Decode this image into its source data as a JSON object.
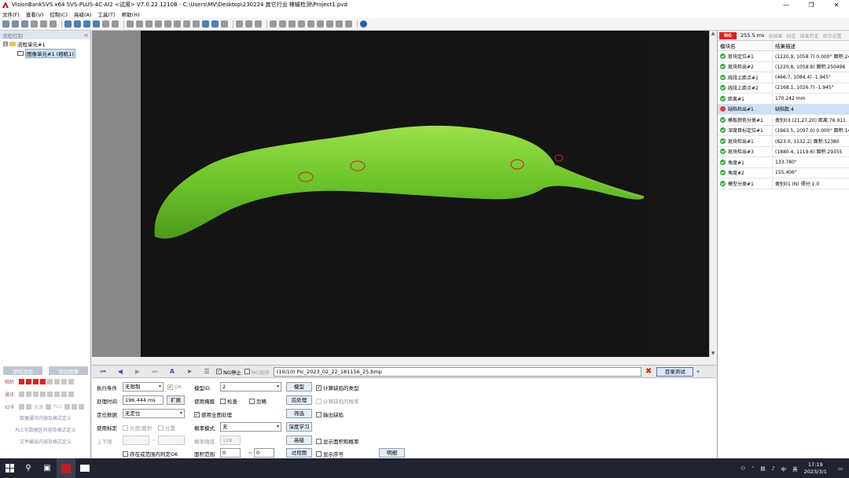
{
  "titlebar": {
    "title": "VisionBankSVS x64 SVS-PLUS-4C-AI2 <试用> V7.0.22.1210B - C:\\Users\\MV\\Desktop\\230224 其它行业 辣椒检测\\Project1.pvd"
  },
  "window_controls": {
    "minimize": "—",
    "restore": "❐",
    "close": "✕"
  },
  "menu": [
    "文件(F)",
    "查看(V)",
    "控制(C)",
    "高级(A)",
    "工具(T)",
    "帮助(H)"
  ],
  "left_panel": {
    "header": "流程控制",
    "pin": "⊲",
    "tree": [
      {
        "expander": "⊟",
        "label": "流程单元#1"
      },
      {
        "label": "图像单元#1 (相机1)"
      }
    ],
    "add_flow": "添加流程",
    "add_image": "添加图像",
    "io": [
      {
        "label": "相机",
        "text1": "",
        "text2": ""
      },
      {
        "label": "通讯",
        "text1": "",
        "text2": ""
      },
      {
        "label": "IO卡",
        "text1": "光源",
        "text2": "PLC"
      }
    ],
    "links": [
      "数据通讯内容及格式定义",
      "PLC写数据区内容及格式定义",
      "文件输出内容及格式定义"
    ]
  },
  "image_bar": {
    "ng_stop": "NG停止",
    "ng_save": "NG另存",
    "filename": "(10/10) Pic_2023_02_22_181156_25.bmp",
    "close": "✖",
    "dir_test": "目录测试",
    "dropdown": "▾"
  },
  "params": {
    "exec_cond_label": "执行条件",
    "exec_cond": "无限制",
    "ok_label": "OK",
    "proc_time_label": "处理时间",
    "proc_time": "196.444 ms",
    "expand": "扩展",
    "locate_label": "定位数据",
    "locate": "无定位",
    "use_calib": "使用标定",
    "length_area": "长度/面积",
    "position": "位置",
    "limit_label": "上下限",
    "limit_sep": "~",
    "judge_ok": "存在或范围内判定OK",
    "model_id_label": "模型ID",
    "model_id": "2",
    "model_btn": "模型",
    "use_mask_label": "使用掩膜",
    "check": "检查",
    "ignore": "忽略",
    "post_proc": "后处理",
    "use_full": "使用全图处理",
    "filter": "筛选",
    "prob_mode_label": "概率模式",
    "prob_mode": "无",
    "deep_learn": "深度学习",
    "prob_thresh_label": "概率阈值",
    "prob_thresh": "128",
    "advanced": "高级",
    "area_range_label": "面积范围",
    "area_min": "0",
    "area_max": "0",
    "area_sep": "~",
    "process_img": "过程图",
    "calc_type": "计算缺陷的类型",
    "calc_prob": "计算缺陷的概率",
    "output_defect": "输出缺陷",
    "show_area_prob": "显示面积和概率",
    "show_order": "显示序号",
    "explain": "明细"
  },
  "right_panel": {
    "status": "NG",
    "time": "255.5 ms",
    "links": [
      "总结果",
      "标定",
      "结果判定",
      "显示设置"
    ],
    "col_module": "模块名",
    "col_result": "结果描述",
    "rows": [
      {
        "status": "ok",
        "name": "斑块定位#1",
        "result": "(1220.9, 1058.7) 0.000° 面积:249"
      },
      {
        "status": "ok",
        "name": "斑块检出#2",
        "result": "(1220.8, 1058.8) 面积:250496"
      },
      {
        "status": "ok",
        "name": "线段上距点#1",
        "result": "(466.7, 1084.4) -1.945°"
      },
      {
        "status": "ok",
        "name": "线段上距点#2",
        "result": "(2168.1, 1026.7) -1.945°"
      },
      {
        "status": "ok",
        "name": "距离#1",
        "result": "170.242 mm"
      },
      {
        "status": "ng",
        "name": "缺陷检出#1",
        "result": "缺陷数:4"
      },
      {
        "status": "ok",
        "name": "模板颜色分类#1",
        "result": "类别03 (21,27,20) 距离:76.911"
      },
      {
        "status": "ok",
        "name": "深度目标定位#1",
        "result": "(1963.5, 1097.0) 0.000° 面积:14("
      },
      {
        "status": "ok",
        "name": "斑块检出#1",
        "result": "(623.0, 1132.2) 面积:52380"
      },
      {
        "status": "ok",
        "name": "斑块检出#3",
        "result": "(1880.4, 1119.6) 面积:29355"
      },
      {
        "status": "ok",
        "name": "角度#1",
        "result": "133.780°"
      },
      {
        "status": "ok",
        "name": "角度#2",
        "result": "155.406°"
      },
      {
        "status": "ok",
        "name": "模型分类#1",
        "result": "类别01 (N) 得分:1.0"
      }
    ]
  },
  "taskbar": {
    "search": "⚲",
    "tray_ime": "中",
    "tray_extra": "英",
    "time": "17:19",
    "date": "2023/3/1",
    "notify": "▭"
  }
}
